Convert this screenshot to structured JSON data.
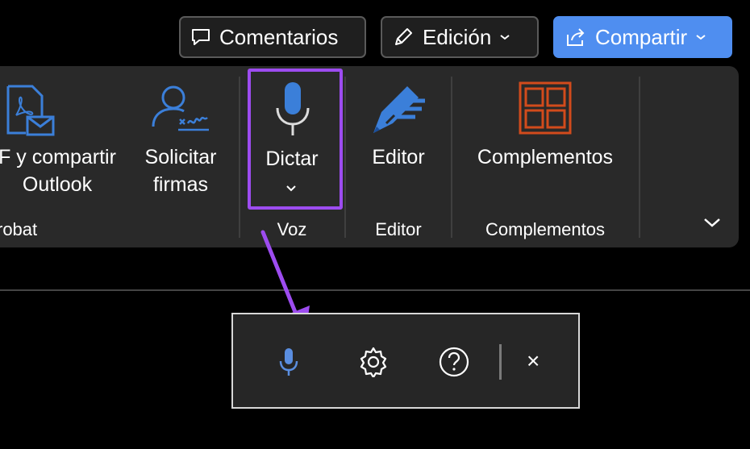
{
  "header": {
    "comments_label": "Comentarios",
    "edit_label": "Edición",
    "share_label": "Compartir"
  },
  "ribbon": {
    "acrobat": {
      "share_outlook_label_line1": "F y compartir",
      "share_outlook_label_line2": "Outlook",
      "request_signatures_line1": "Solicitar",
      "request_signatures_line2": "firmas",
      "group_label": "robat"
    },
    "voice": {
      "dictate_label": "Dictar",
      "group_label": "Voz"
    },
    "editor": {
      "editor_label": "Editor",
      "group_label": "Editor"
    },
    "addins": {
      "addins_label": "Complementos",
      "group_label": "Complementos"
    }
  },
  "dictation_toolbar": {
    "close_glyph": "×"
  },
  "colors": {
    "highlight": "#9d4cf0",
    "accent_blue": "#4f8ef0",
    "addins_orange": "#d24b1c"
  }
}
